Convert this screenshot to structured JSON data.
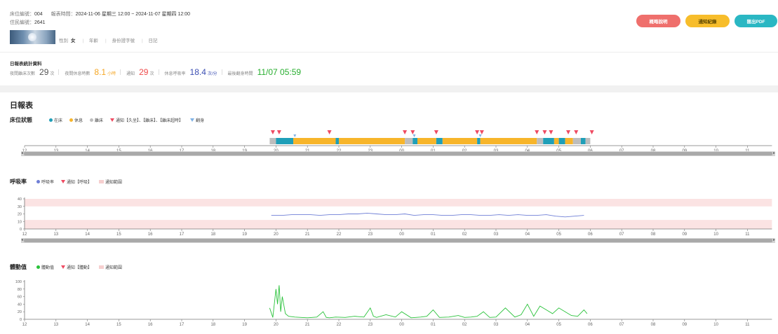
{
  "header": {
    "bed_no_label": "床位編號：",
    "bed_no_value": "004",
    "report_time_label": "報表時間：",
    "report_time_value": "2024-11-06 星期三 12:00 ~ 2024-11-07 星期四 12:00",
    "resident_no_label": "住民編號：",
    "resident_no_value": "2641",
    "profile": {
      "gender_label": "性別",
      "gender_value": "女",
      "age_label": "年齡",
      "id_label": "身份證字號",
      "note_label": "日記"
    },
    "buttons": {
      "red": "概略說明",
      "yellow": "通知紀錄",
      "teal": "匯出PDF"
    }
  },
  "stats": {
    "title": "日報表統計資料",
    "items": [
      {
        "label": "夜間離床次數",
        "value": "29",
        "unit": "次"
      },
      {
        "label": "夜間休息時數",
        "value": "8.1",
        "unit": "小時"
      },
      {
        "label": "通知",
        "value": "29",
        "unit": "次"
      },
      {
        "label": "休息呼吸率",
        "value": "18.4",
        "unit": "次/分"
      },
      {
        "label": "最後翻身時間",
        "value": "11/07 05:59",
        "unit": ""
      }
    ]
  },
  "report": {
    "title": "日報表",
    "bed_section": {
      "title": "床位狀態",
      "legend": [
        "在床",
        "休息",
        "離床",
        "通知【久坐】、【離床】、【離床超時】",
        "翻身"
      ]
    },
    "resp_section": {
      "title": "呼吸率",
      "legend": [
        "呼吸率",
        "通知【呼吸】",
        "通知範圍"
      ]
    },
    "motion_section": {
      "title": "體動值",
      "legend": [
        "體動值",
        "通知【體動】",
        "通知範圍"
      ]
    }
  },
  "colors": {
    "in_bed": "#1f9fb8",
    "rest": "#f7b52b",
    "off_bed": "#bdbdbd",
    "alert": "#ef4b62",
    "turn": "#7fb2e6",
    "resp": "#6f7fd6",
    "motion": "#29c23a",
    "alert_range": "#fbe3e3"
  },
  "chart_data": [
    {
      "type": "bar",
      "name": "bed_status",
      "x_ticks": [
        "12",
        "13",
        "14",
        "15",
        "16",
        "17",
        "18",
        "19",
        "20",
        "21",
        "22",
        "23",
        "00",
        "01",
        "02",
        "03",
        "04",
        "05",
        "06",
        "07",
        "08",
        "09",
        "10",
        "11"
      ],
      "x_unit": "hours since 12:00",
      "segments": [
        {
          "start": 7.8,
          "end": 8.0,
          "state": "off_bed"
        },
        {
          "start": 8.0,
          "end": 8.55,
          "state": "in_bed"
        },
        {
          "start": 8.55,
          "end": 9.9,
          "state": "rest"
        },
        {
          "start": 9.9,
          "end": 10.0,
          "state": "in_bed"
        },
        {
          "start": 10.0,
          "end": 12.1,
          "state": "rest"
        },
        {
          "start": 12.1,
          "end": 12.35,
          "state": "off_bed"
        },
        {
          "start": 12.35,
          "end": 12.5,
          "state": "in_bed"
        },
        {
          "start": 12.5,
          "end": 13.1,
          "state": "rest"
        },
        {
          "start": 13.1,
          "end": 13.3,
          "state": "in_bed"
        },
        {
          "start": 13.3,
          "end": 14.4,
          "state": "rest"
        },
        {
          "start": 14.4,
          "end": 14.5,
          "state": "in_bed"
        },
        {
          "start": 14.5,
          "end": 16.3,
          "state": "rest"
        },
        {
          "start": 16.3,
          "end": 16.5,
          "state": "off_bed"
        },
        {
          "start": 16.5,
          "end": 16.85,
          "state": "in_bed"
        },
        {
          "start": 16.85,
          "end": 17.0,
          "state": "rest"
        },
        {
          "start": 17.0,
          "end": 17.2,
          "state": "in_bed"
        },
        {
          "start": 17.2,
          "end": 17.45,
          "state": "rest"
        },
        {
          "start": 17.45,
          "end": 17.7,
          "state": "off_bed"
        },
        {
          "start": 17.7,
          "end": 17.85,
          "state": "in_bed"
        },
        {
          "start": 17.85,
          "end": 18.0,
          "state": "off_bed"
        }
      ],
      "alerts": [
        7.9,
        8.1,
        9.7,
        12.1,
        12.35,
        13.1,
        14.4,
        14.55,
        16.3,
        16.55,
        16.75,
        17.3,
        17.55,
        18.05
      ],
      "turns": [
        8.6,
        12.4,
        14.5
      ]
    },
    {
      "type": "line",
      "name": "respiration",
      "x_ticks": [
        "12",
        "13",
        "14",
        "15",
        "16",
        "17",
        "18",
        "19",
        "20",
        "21",
        "22",
        "23",
        "00",
        "01",
        "02",
        "03",
        "04",
        "05",
        "06",
        "07",
        "08",
        "09",
        "10",
        "11"
      ],
      "y_ticks": [
        0,
        10,
        20,
        30,
        40
      ],
      "ylim": [
        0,
        40
      ],
      "alert_bands": [
        [
          0,
          12
        ],
        [
          30,
          40
        ]
      ],
      "x": [
        7.85,
        8.2,
        8.5,
        8.8,
        9.1,
        9.4,
        9.7,
        10.0,
        10.3,
        10.6,
        10.9,
        11.2,
        11.5,
        11.8,
        12.1,
        12.4,
        12.7,
        13.0,
        13.3,
        13.6,
        13.9,
        14.2,
        14.5,
        14.8,
        15.1,
        15.4,
        15.7,
        16.0,
        16.3,
        16.6,
        16.9,
        17.2,
        17.5,
        17.8
      ],
      "values": [
        18,
        18,
        19,
        19,
        19,
        18,
        19,
        19,
        20,
        20,
        21,
        20,
        19,
        19,
        20,
        18,
        19,
        19,
        18,
        18,
        19,
        19,
        18,
        18,
        19,
        18,
        19,
        18,
        18,
        19,
        17,
        16,
        17,
        18
      ]
    },
    {
      "type": "line",
      "name": "motion",
      "x_ticks": [
        "12",
        "13",
        "14",
        "15",
        "16",
        "17",
        "18",
        "19",
        "20",
        "21",
        "22",
        "23",
        "00",
        "01",
        "02",
        "03",
        "04",
        "05",
        "06",
        "07",
        "08",
        "09",
        "10",
        "11"
      ],
      "y_ticks": [
        0,
        20,
        40,
        60,
        80,
        100
      ],
      "ylim": [
        0,
        100
      ],
      "x": [
        7.8,
        7.9,
        8.0,
        8.05,
        8.1,
        8.15,
        8.2,
        8.3,
        8.4,
        8.6,
        8.8,
        9.0,
        9.3,
        9.5,
        9.6,
        9.7,
        9.9,
        10.2,
        10.5,
        10.8,
        11.0,
        11.1,
        11.2,
        11.5,
        11.8,
        12.0,
        12.3,
        12.6,
        12.8,
        13.0,
        13.2,
        13.5,
        13.8,
        14.0,
        14.2,
        14.4,
        14.6,
        14.8,
        15.0,
        15.3,
        15.6,
        15.8,
        16.0,
        16.2,
        16.4,
        16.6,
        16.8,
        17.0,
        17.2,
        17.4,
        17.6,
        17.8,
        17.9
      ],
      "values": [
        30,
        5,
        80,
        40,
        90,
        20,
        60,
        15,
        8,
        6,
        5,
        4,
        6,
        20,
        5,
        4,
        6,
        5,
        8,
        6,
        30,
        8,
        5,
        12,
        6,
        20,
        4,
        6,
        8,
        25,
        5,
        6,
        10,
        5,
        6,
        8,
        20,
        5,
        6,
        30,
        6,
        12,
        40,
        8,
        35,
        25,
        15,
        30,
        20,
        10,
        8,
        25,
        15
      ]
    }
  ]
}
